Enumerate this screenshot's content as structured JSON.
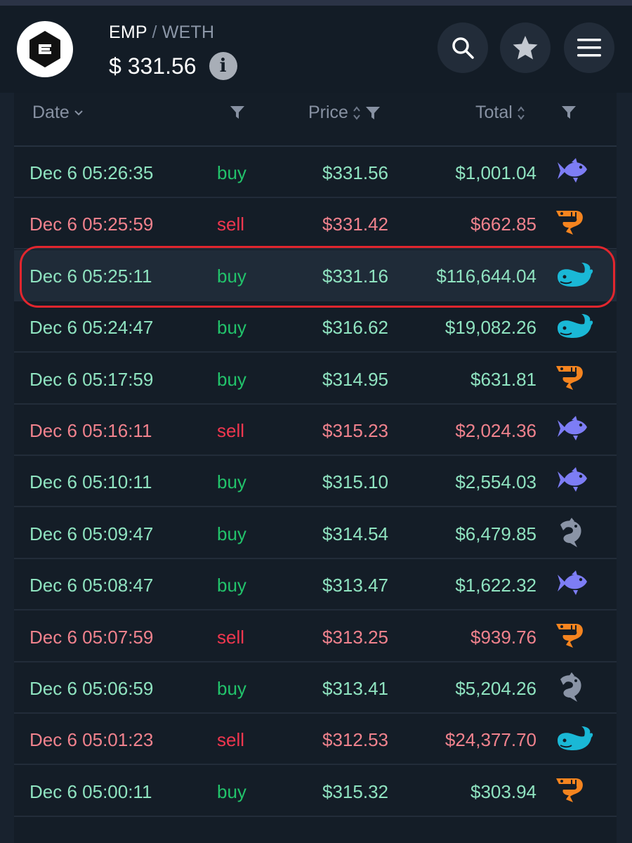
{
  "header": {
    "base": "EMP",
    "separator": "/",
    "quote": "WETH",
    "price": "$ 331.56",
    "info_symbol": "i"
  },
  "columns": {
    "date": "Date",
    "price": "Price",
    "total": "Total"
  },
  "colors": {
    "buy_text": "#8fe3c0",
    "sell_text": "#f0828d",
    "buy_side": "#22c36b",
    "sell_side": "#f0374f",
    "fish": "#7d7df5",
    "shrimp": "#f5841f",
    "whale": "#1ab8d6",
    "dolphin": "#8a94a6",
    "annotation": "#e2262e"
  },
  "trades": [
    {
      "date": "Dec 6 05:26:35",
      "side": "buy",
      "price": "$331.56",
      "total": "$1,001.04",
      "icon": "fish-icon"
    },
    {
      "date": "Dec 6 05:25:59",
      "side": "sell",
      "price": "$331.42",
      "total": "$662.85",
      "icon": "shrimp-icon"
    },
    {
      "date": "Dec 6 05:25:11",
      "side": "buy",
      "price": "$331.16",
      "total": "$116,644.04",
      "icon": "whale-icon",
      "highlighted": true
    },
    {
      "date": "Dec 6 05:24:47",
      "side": "buy",
      "price": "$316.62",
      "total": "$19,082.26",
      "icon": "whale-icon"
    },
    {
      "date": "Dec 6 05:17:59",
      "side": "buy",
      "price": "$314.95",
      "total": "$631.81",
      "icon": "shrimp-icon"
    },
    {
      "date": "Dec 6 05:16:11",
      "side": "sell",
      "price": "$315.23",
      "total": "$2,024.36",
      "icon": "fish-icon"
    },
    {
      "date": "Dec 6 05:10:11",
      "side": "buy",
      "price": "$315.10",
      "total": "$2,554.03",
      "icon": "fish-icon"
    },
    {
      "date": "Dec 6 05:09:47",
      "side": "buy",
      "price": "$314.54",
      "total": "$6,479.85",
      "icon": "dolphin-icon"
    },
    {
      "date": "Dec 6 05:08:47",
      "side": "buy",
      "price": "$313.47",
      "total": "$1,622.32",
      "icon": "fish-icon"
    },
    {
      "date": "Dec 6 05:07:59",
      "side": "sell",
      "price": "$313.25",
      "total": "$939.76",
      "icon": "shrimp-icon"
    },
    {
      "date": "Dec 6 05:06:59",
      "side": "buy",
      "price": "$313.41",
      "total": "$5,204.26",
      "icon": "dolphin-icon"
    },
    {
      "date": "Dec 6 05:01:23",
      "side": "sell",
      "price": "$312.53",
      "total": "$24,377.70",
      "icon": "whale-icon"
    },
    {
      "date": "Dec 6 05:00:11",
      "side": "buy",
      "price": "$315.32",
      "total": "$303.94",
      "icon": "shrimp-icon"
    }
  ]
}
